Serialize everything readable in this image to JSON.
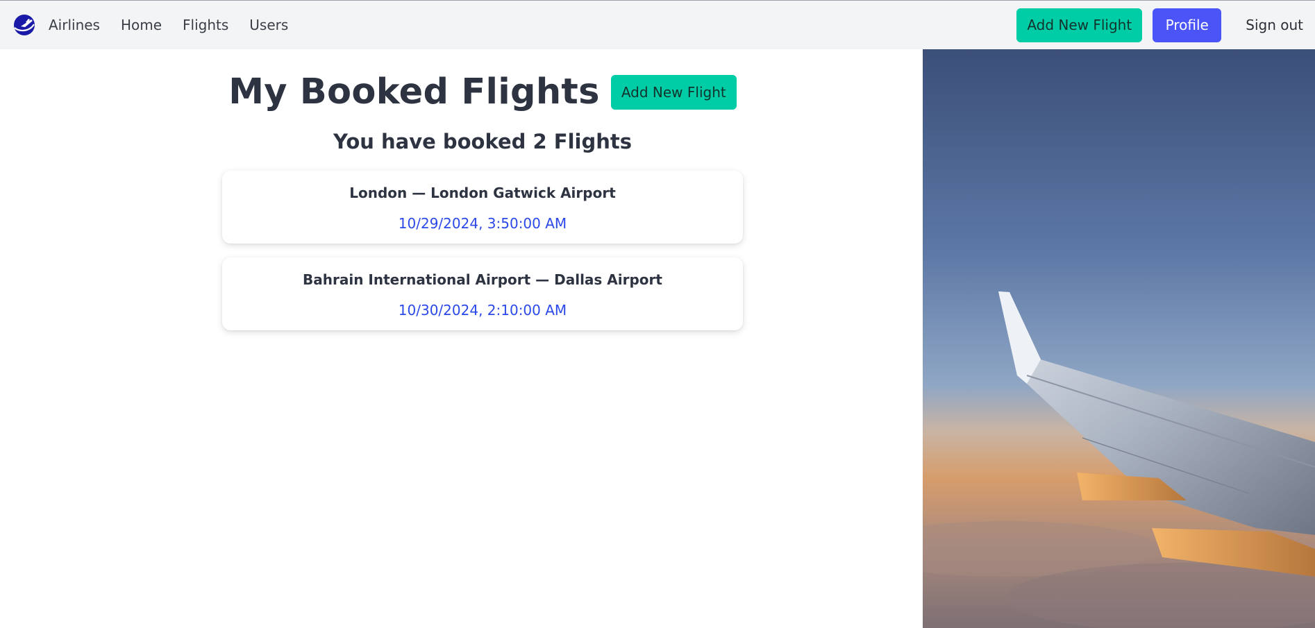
{
  "navbar": {
    "brand_text": "Airlines",
    "logo_icon": "plane-globe-logo-icon",
    "links": [
      "Home",
      "Flights",
      "Users"
    ],
    "add_flight_label": "Add New Flight",
    "profile_label": "Profile",
    "sign_out_label": "Sign out"
  },
  "main": {
    "title": "My Booked Flights",
    "title_button_label": "Add New Flight",
    "subtitle": "You have booked 2 Flights",
    "flights": [
      {
        "route": "London — London Gatwick Airport",
        "datetime": "10/29/2024, 3:50:00 AM"
      },
      {
        "route": "Bahrain International Airport — Dallas Airport",
        "datetime": "10/30/2024, 2:10:00 AM"
      }
    ]
  },
  "side_image": {
    "subject": "airplane-wing-over-clouds-at-sunset"
  },
  "colors": {
    "accent_green": "#00cda6",
    "accent_blue": "#4b55f7",
    "date_blue": "#2b48e8",
    "nav_bg": "#f3f4f6",
    "text_dark": "#2d3340"
  }
}
